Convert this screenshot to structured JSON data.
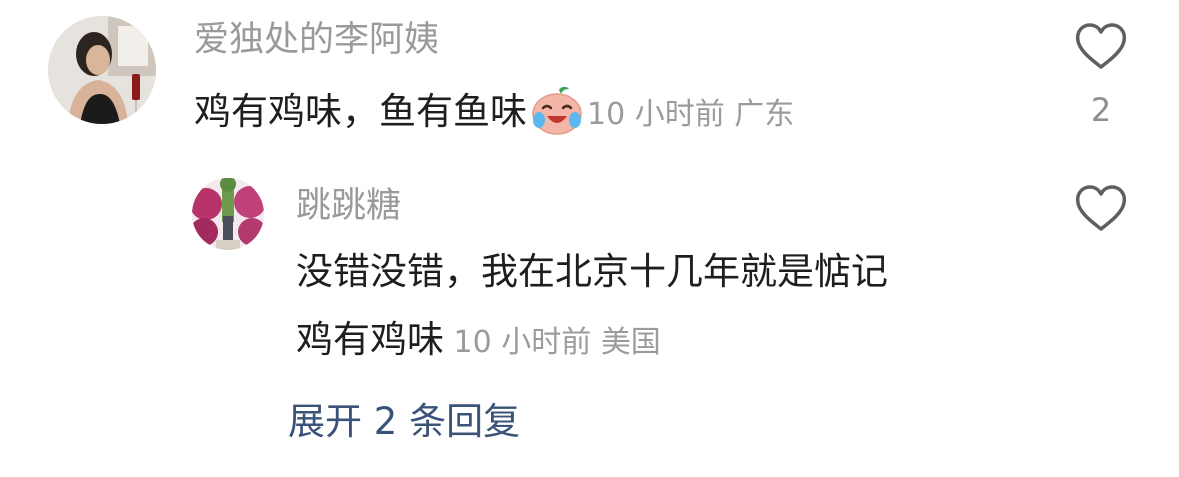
{
  "comments": [
    {
      "username": "爱独处的李阿姨",
      "text": "鸡有鸡味，鱼有鱼味",
      "emoji": "laughing-crying-emoji",
      "time": "10 小时前",
      "location": "广东",
      "likes": "2",
      "replies": [
        {
          "username": "跳跳糖",
          "text_line1": "没错没错，我在北京十几年就是惦记",
          "text_line2": "鸡有鸡味",
          "time": "10 小时前",
          "location": "美国"
        }
      ]
    }
  ],
  "expand_replies": "展开 2 条回复",
  "colors": {
    "username": "#9a9a9a",
    "text": "#1e1e1e",
    "meta": "#9b9b9b",
    "expand_link": "#3b5378",
    "icon": "#5f5f5f"
  }
}
